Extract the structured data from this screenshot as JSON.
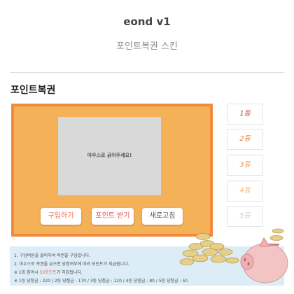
{
  "header": {
    "title": "eond v1",
    "subtitle": "포인트복권 스킨"
  },
  "section": {
    "title": "포인트복권"
  },
  "scratch": {
    "prompt": "마우스로 긁어주세요!"
  },
  "buttons": {
    "buy": "구입하기",
    "point": "포인트 받기",
    "refresh": "새로고침"
  },
  "ranks": [
    {
      "label": "1등",
      "color": "#c0392b"
    },
    {
      "label": "2등",
      "color": "#e07a3f"
    },
    {
      "label": "3등",
      "color": "#e8944b"
    },
    {
      "label": "4등",
      "color": "#f0b570"
    },
    {
      "label": "5등",
      "color": "#cfcfcf"
    }
  ],
  "notice": {
    "line1": "1. 구입버튼을 클릭하여 복권을 구입합니다.",
    "line2": "2. 마우스로 복권을 긁으면 당첨여부에 따라 포인트가 지급됩니다.",
    "line3_pre": "※ 1회 참여시 ",
    "line3_hl": "50포인트",
    "line3_post": "가 차감됩니다.",
    "line4": "※ 1등 당첨금 : 220 / 2등 당첨금 : 170 / 3등 당첨금 : 120 / 4등 당첨금 : 80 / 5등 당첨금 : 50"
  },
  "colors": {
    "board_bg": "#f4b157",
    "board_border": "#f28a3a",
    "scratch_area": "#d9d9d9",
    "notice_bg": "#dcedf7"
  },
  "icons": {
    "coins": "coin-pile-icon",
    "piggy": "piggy-bank-icon"
  }
}
